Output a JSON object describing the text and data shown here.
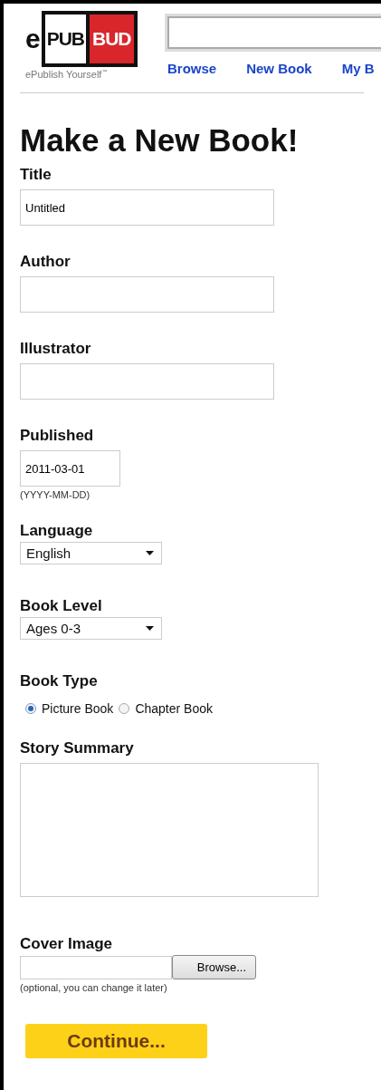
{
  "logo": {
    "letter": "e",
    "left_word": "PUB",
    "right_word": "BUD",
    "tagline": "ePublish Yourself",
    "trademark": "™"
  },
  "nav": [
    {
      "label": "Browse"
    },
    {
      "label": "New Book"
    },
    {
      "label": "My B"
    }
  ],
  "heading": "Make a New Book!",
  "fields": [
    {
      "kind": "text",
      "label": "Title",
      "value": "Untitled"
    },
    {
      "kind": "text",
      "label": "Author"
    },
    {
      "kind": "text",
      "label": "Illustrator"
    },
    {
      "kind": "date",
      "label": "Published",
      "value": "2011-03-01",
      "hint": "(YYYY-MM-DD)"
    },
    {
      "kind": "select",
      "label": "Language",
      "value": "English"
    },
    {
      "kind": "select",
      "label": "Book Level",
      "value": "Ages 0-3"
    },
    {
      "kind": "radio",
      "label": "Book Type",
      "options": [
        {
          "label": "Picture Book",
          "selected": true
        },
        {
          "label": "Chapter Book",
          "selected": false
        }
      ]
    },
    {
      "kind": "textarea",
      "label": "Story Summary"
    },
    {
      "kind": "file",
      "label": "Cover Image",
      "button": "Browse...",
      "hint": "(optional, you can change it later)"
    }
  ],
  "submit": "Continue..."
}
